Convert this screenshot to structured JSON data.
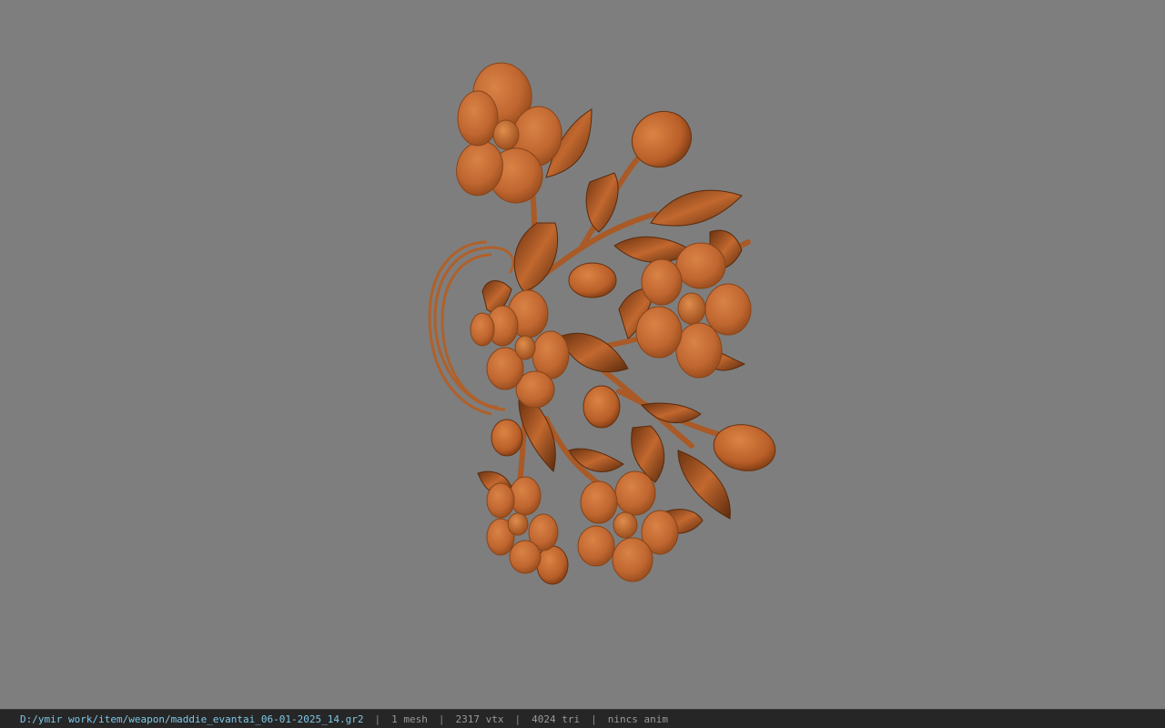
{
  "status_bar": {
    "file_path": "D:/ymir work/item/weapon/maddie_evantai_06-01-2025_14.gr2",
    "separator": "|",
    "mesh_count": "1 mesh",
    "vertex_count": "2317 vtx",
    "triangle_count": "4024 tri",
    "anim_status": "nincs anim"
  },
  "viewport": {
    "background_color": "#7e7e7e",
    "model_color": "#c46a33",
    "model_description_icon": "flower-branch-model"
  }
}
